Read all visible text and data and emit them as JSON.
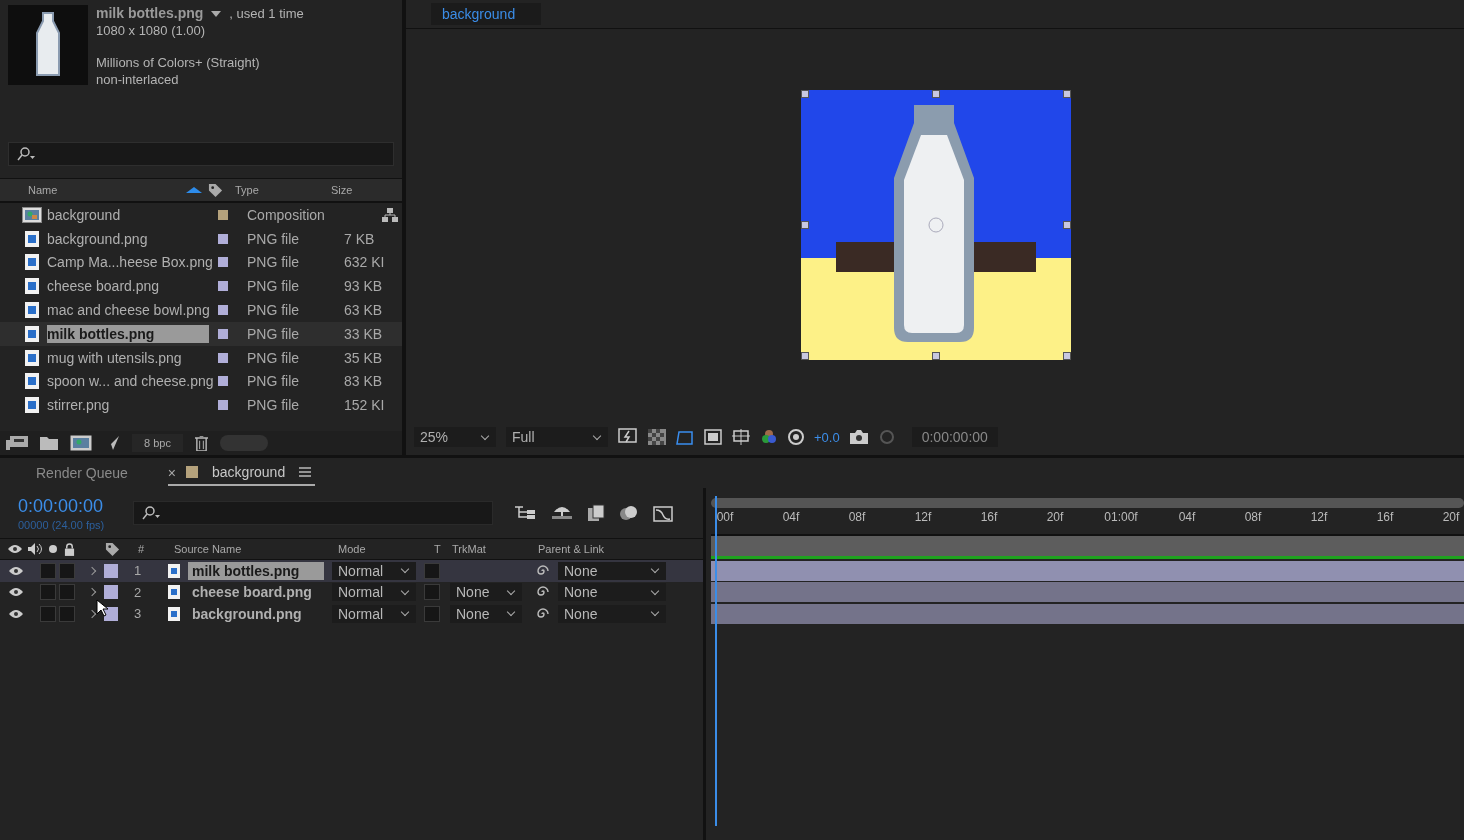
{
  "project": {
    "preview": {
      "name": "milk bottles.png",
      "usage": ", used 1 time",
      "dimensions": "1080 x 1080 (1.00)",
      "color_depth": "Millions of Colors+ (Straight)",
      "interlace": "non-interlaced"
    },
    "columns": [
      "Name",
      "Type",
      "Size"
    ],
    "items": [
      {
        "name": "background",
        "kind": "composition",
        "type": "Composition",
        "color": "#b5a27c",
        "selected": false
      },
      {
        "name": "background.png",
        "kind": "image",
        "type": "PNG file",
        "size": "7 KB",
        "color": "#b0aed8",
        "selected": false
      },
      {
        "name": "Camp Ma...heese Box.png",
        "kind": "image",
        "type": "PNG file",
        "size": "632 KI",
        "color": "#b0aed8",
        "selected": false
      },
      {
        "name": "cheese board.png",
        "kind": "image",
        "type": "PNG file",
        "size": "93 KB",
        "color": "#b0aed8",
        "selected": false
      },
      {
        "name": "mac and cheese bowl.png",
        "kind": "image",
        "type": "PNG file",
        "size": "63 KB",
        "color": "#b0aed8",
        "selected": false
      },
      {
        "name": "milk bottles.png",
        "kind": "image",
        "type": "PNG file",
        "size": "33 KB",
        "color": "#b0aed8",
        "selected": true
      },
      {
        "name": "mug with utensils.png",
        "kind": "image",
        "type": "PNG file",
        "size": "35 KB",
        "color": "#b0aed8",
        "selected": false
      },
      {
        "name": "spoon w... and cheese.png",
        "kind": "image",
        "type": "PNG file",
        "size": "83 KB",
        "color": "#b0aed8",
        "selected": false
      },
      {
        "name": "stirrer.png",
        "kind": "image",
        "type": "PNG file",
        "size": "152 KI",
        "color": "#b0aed8",
        "selected": false
      }
    ],
    "bpc": "8 bpc"
  },
  "viewer": {
    "tab": "background",
    "zoom": "25%",
    "resolution": "Full",
    "exposure": "+0.0",
    "timecode": "0:00:00:00"
  },
  "timeline": {
    "tabs": [
      {
        "label": "Render Queue",
        "selected": false
      },
      {
        "label": "background",
        "selected": true,
        "color": "#b5a27c",
        "close": "×"
      }
    ],
    "timecode": "0:00:00:00",
    "frame_info": "00000 (24.00 fps)",
    "columns": [
      "#",
      "Source Name",
      "Mode",
      "T",
      "TrkMat",
      "Parent & Link"
    ],
    "layers": [
      {
        "number": "1",
        "name": "milk bottles.png",
        "mode": "Normal",
        "parent": "None",
        "selected": true,
        "color": "#b0aed8"
      },
      {
        "number": "2",
        "name": "cheese board.png",
        "mode": "Normal",
        "trkmat": "None",
        "parent": "None",
        "selected": false,
        "color": "#b0aed8"
      },
      {
        "number": "3",
        "name": "background.png",
        "mode": "Normal",
        "trkmat": "None",
        "parent": "None",
        "selected": false,
        "color": "#b0aed8"
      }
    ],
    "ruler": [
      "00f",
      "04f",
      "08f",
      "12f",
      "16f",
      "20f",
      "01:00f",
      "04f",
      "08f",
      "12f",
      "16f",
      "20f"
    ]
  }
}
